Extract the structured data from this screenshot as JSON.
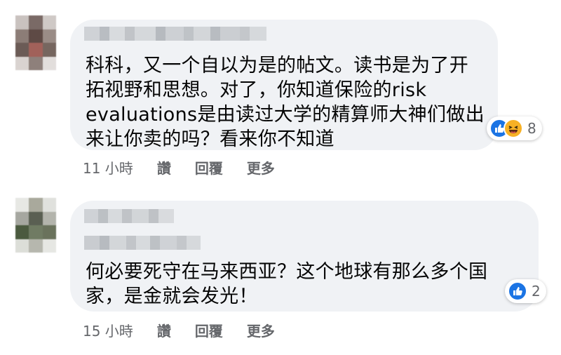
{
  "comments": [
    {
      "text": "科科，又一个自以为是的帖文。读书是为了开\n拓视野和思想。对了，你知道保险的risk\nevaluations是由读过大学的精算师大神们做出\n来让你卖的吗？看来你不知道",
      "reaction_count": "8",
      "time": "11 小時",
      "like_label": "讚",
      "reply_label": "回覆",
      "more_label": "更多"
    },
    {
      "text": "何必要死守在马来西亚？这个地球有那么多个国\n家，是金就会发光！",
      "reaction_count": "2",
      "time": "15 小時",
      "like_label": "讚",
      "reply_label": "回覆",
      "more_label": "更多"
    }
  ],
  "colors": {
    "bubble": "#f0f2f5",
    "like_blue": "#1b74e4",
    "haha_yellow": "#f7b125",
    "meta_gray": "#65676b"
  },
  "icons": [
    "like-icon",
    "haha-icon"
  ]
}
